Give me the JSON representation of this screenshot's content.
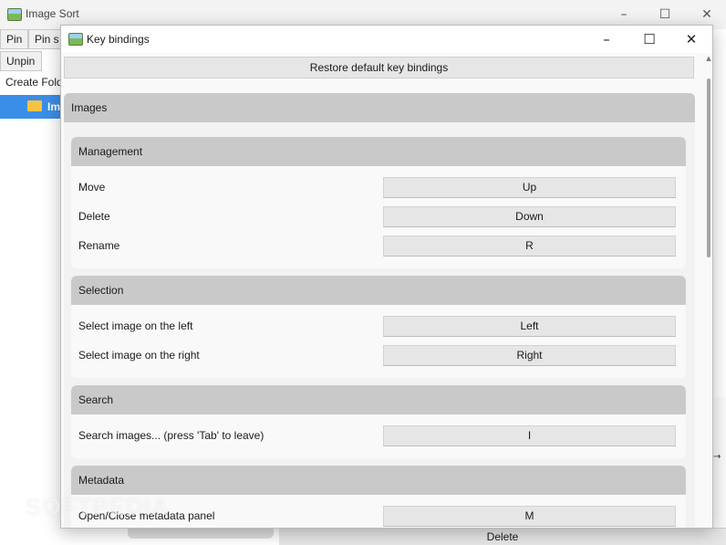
{
  "background_window": {
    "title": "Image Sort",
    "controls": {
      "minimize": "–",
      "maximize": "☐",
      "close": "✕"
    },
    "buttons": {
      "pin": "Pin",
      "pin_s": "Pin s",
      "unpin": "Unpin",
      "create_folder": "Create Fold"
    },
    "tree_item": "Im",
    "bottom_button": "Delete",
    "arrow": "→"
  },
  "dialog": {
    "title": "Key bindings",
    "controls": {
      "minimize": "–",
      "maximize": "☐",
      "close": "✕"
    },
    "restore_label": "Restore default key bindings",
    "group_title": "Images",
    "sections": {
      "management": {
        "title": "Management",
        "rows": [
          {
            "action": "Move",
            "key": "Up"
          },
          {
            "action": "Delete",
            "key": "Down"
          },
          {
            "action": "Rename",
            "key": "R"
          }
        ]
      },
      "selection": {
        "title": "Selection",
        "rows": [
          {
            "action": "Select image on the left",
            "key": "Left"
          },
          {
            "action": "Select image on the right",
            "key": "Right"
          }
        ]
      },
      "search": {
        "title": "Search",
        "rows": [
          {
            "action": "Search images... (press 'Tab' to leave)",
            "key": "I"
          }
        ]
      },
      "metadata": {
        "title": "Metadata",
        "rows": [
          {
            "action": "Open/Close metadata panel",
            "key": "M"
          }
        ]
      }
    },
    "scroll_up_glyph": "▲"
  },
  "watermark": "SOFTPEDIA",
  "colors": {
    "accent": "#3b8ee8",
    "header_bg": "#c9c9c9",
    "button_bg": "#e6e6e6"
  }
}
